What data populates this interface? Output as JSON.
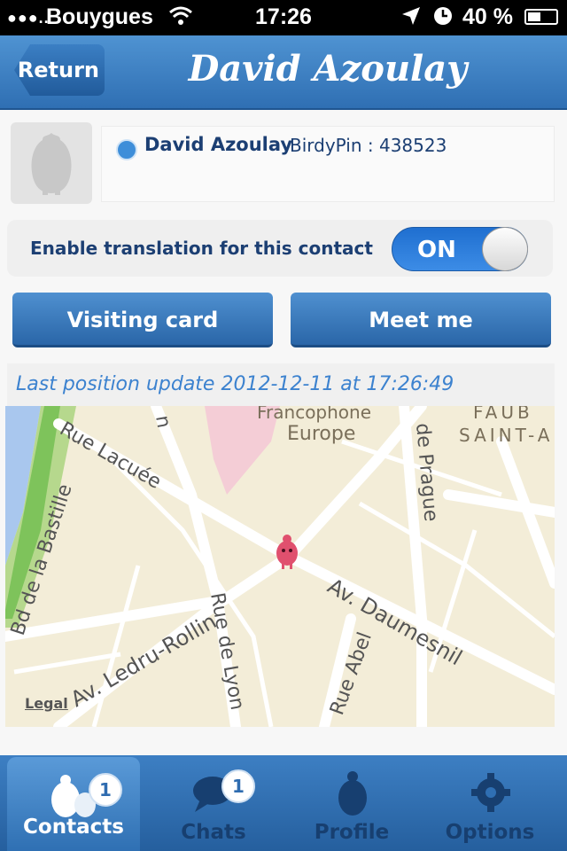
{
  "status_bar": {
    "signal": "●●●..",
    "carrier": "Bouygues",
    "time": "17:26",
    "battery": "40 %"
  },
  "nav": {
    "back_label": "Return",
    "title": "David Azoulay"
  },
  "contact": {
    "name": "David Azoulay",
    "pin": "BirdyPin : 438523",
    "status_color": "#3e8ed9"
  },
  "translation": {
    "label": "Enable translation for this contact",
    "toggle_state": "ON"
  },
  "actions": {
    "visiting_card": "Visiting card",
    "meet_me": "Meet me"
  },
  "last_position": "Last position update 2012-12-11 at 17:26:49",
  "map": {
    "labels": [
      "Francophone",
      "Europe",
      "FAUB",
      "SAINT-A",
      "Rue Lacuée",
      "Bd de la Bastille",
      "de Prague",
      "Av. Daumesnil",
      "Av. Ledru-Rollin",
      "Rue de Lyon",
      "Rue Abel",
      "n"
    ],
    "legal": "Legal"
  },
  "tabs": [
    {
      "label": "Contacts",
      "badge": "1",
      "active": true,
      "icon": "birds-icon"
    },
    {
      "label": "Chats",
      "badge": "1",
      "active": false,
      "icon": "chat-bubble-icon"
    },
    {
      "label": "Profile",
      "active": false,
      "icon": "bird-icon"
    },
    {
      "label": "Options",
      "active": false,
      "icon": "gear-icon"
    }
  ],
  "colors": {
    "accent": "#2f6fb3",
    "text_dark": "#1c3f73",
    "link": "#3c82cf"
  }
}
